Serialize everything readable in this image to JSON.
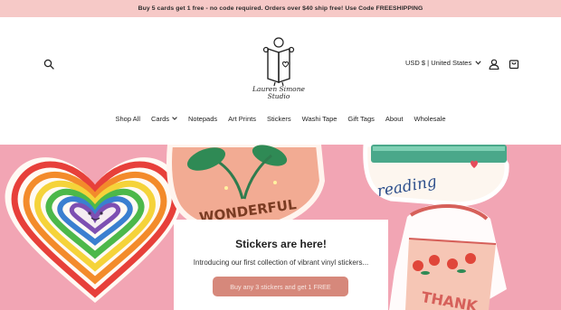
{
  "announcement": {
    "text": "Buy 5 cards get 1 free - no code required. Orders over $40 ship free! Use Code FREESHIPPING"
  },
  "header": {
    "search_icon": "search-icon",
    "logo_lines": [
      "Lauren Simone",
      "Studio"
    ],
    "currency": "USD $ | United States",
    "account_icon": "user-icon",
    "cart_icon": "bag-icon"
  },
  "nav": {
    "items": [
      "Shop All",
      "Cards",
      "Notepads",
      "Art Prints",
      "Stickers",
      "Washi Tape",
      "Gift Tags",
      "About",
      "Wholesale"
    ]
  },
  "hero": {
    "sticker_words": [
      "WONDERFUL",
      "reading",
      "THANK"
    ],
    "promo": {
      "title": "Stickers are here!",
      "description": "Introducing our first collection of vibrant vinyl stickers...",
      "button": "Buy any 3 stickers and get 1 FREE"
    }
  },
  "colors": {
    "announcement_bg": "#f6c9c7",
    "hero_bg": "#f2a5b4",
    "button_bg": "#d6887b"
  }
}
